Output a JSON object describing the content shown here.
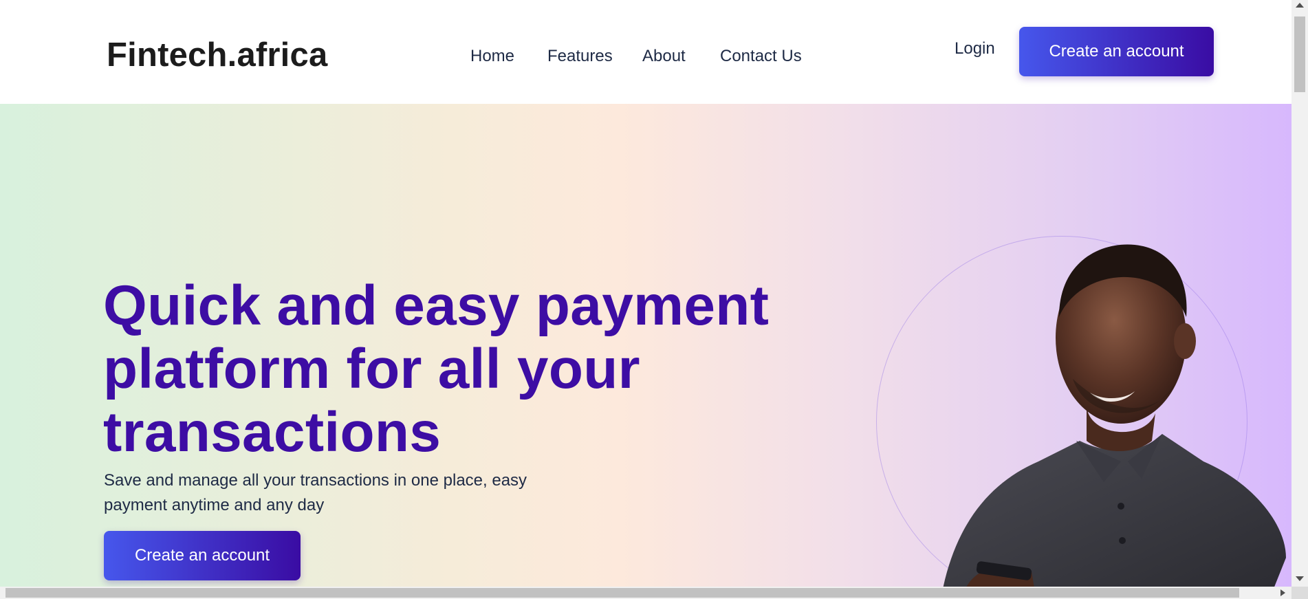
{
  "header": {
    "logo": "Fintech.africa",
    "nav": [
      {
        "label": "Home"
      },
      {
        "label": "Features"
      },
      {
        "label": "About"
      },
      {
        "label": "Contact Us"
      }
    ],
    "login_label": "Login",
    "cta_label": "Create an account"
  },
  "hero": {
    "headline": "Quick and easy payment platform for all your transactions",
    "subtext": "Save and manage all your transactions in one place, easy payment anytime and any day",
    "cta_label": "Create an account"
  },
  "colors": {
    "brand_primary": "#3d0da4",
    "button_gradient_start": "#4657ec",
    "button_gradient_end": "#3a0ca3",
    "hero_left": "#d8f1dd",
    "hero_right": "#d7b8fd"
  },
  "icons": {
    "scroll_up": "chevron-up-icon",
    "scroll_down": "chevron-down-icon",
    "scroll_right": "chevron-right-icon"
  }
}
